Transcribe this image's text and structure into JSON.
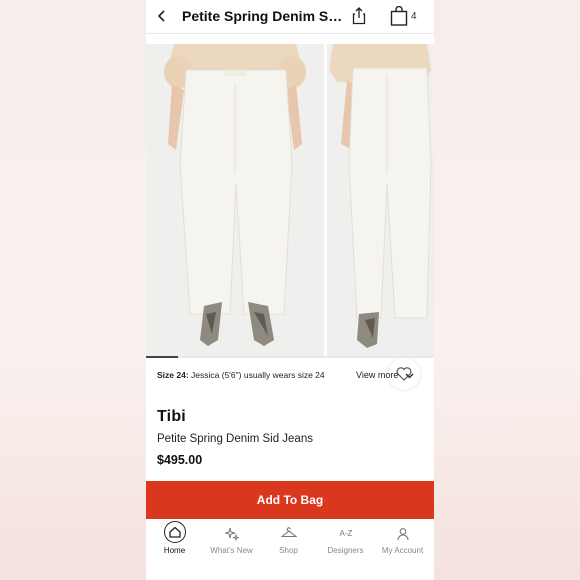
{
  "header": {
    "title": "Petite Spring Denim Sid Jeans",
    "bag_count": "4"
  },
  "gallery": {
    "photo_count": 2,
    "progress_fraction": 0.11
  },
  "size_info": {
    "label": "Size 24:",
    "text": "Jessica (5'6\") usually wears size 24",
    "view_more": "View more"
  },
  "product": {
    "brand": "Tibi",
    "name": "Petite Spring Denim Sid Jeans",
    "price": "$495.00"
  },
  "cta": {
    "add_to_bag": "Add To Bag",
    "color": "#d9381e"
  },
  "nav": {
    "items": [
      {
        "label": "Home",
        "icon": "home-icon",
        "active": true
      },
      {
        "label": "What's New",
        "icon": "sparkle-icon",
        "active": false
      },
      {
        "label": "Shop",
        "icon": "hanger-icon",
        "active": false
      },
      {
        "label": "Designers",
        "icon": "a-z-icon",
        "active": false
      },
      {
        "label": "My Account",
        "icon": "person-icon",
        "active": false
      }
    ]
  }
}
